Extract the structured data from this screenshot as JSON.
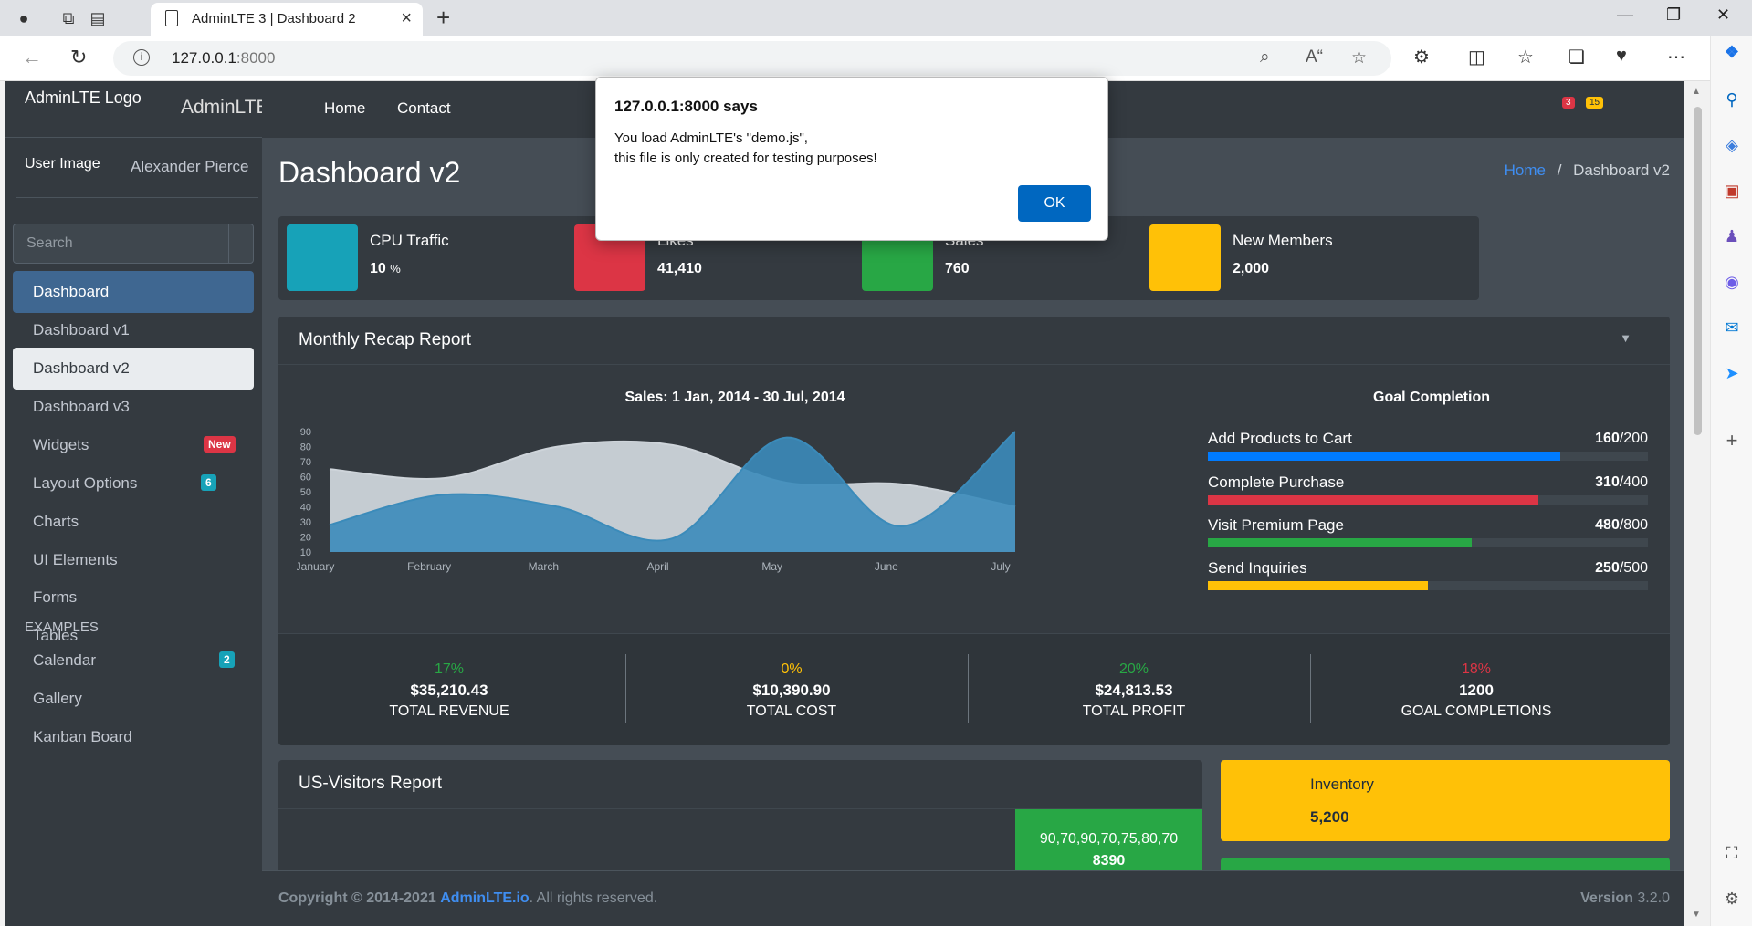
{
  "browser": {
    "tab_title": "AdminLTE 3 | Dashboard 2",
    "url_host": "127.0.0.1",
    "url_port": ":8000"
  },
  "dialog": {
    "title": "127.0.0.1:8000 says",
    "line1": "You load AdminLTE's \"demo.js\",",
    "line2": "this file is only created for testing purposes!",
    "ok_label": "OK"
  },
  "brand": {
    "logo_alt": "AdminLTE Logo",
    "text": "AdminLTE"
  },
  "user": {
    "image_alt": "User Image",
    "name": "Alexander Pierce"
  },
  "search": {
    "placeholder": "Search"
  },
  "sidebar": {
    "items": [
      {
        "label": "Dashboard"
      },
      {
        "label": "Dashboard v1"
      },
      {
        "label": "Dashboard v2"
      },
      {
        "label": "Dashboard v3"
      },
      {
        "label": "Widgets",
        "badge": "New"
      },
      {
        "label": "Layout Options",
        "badge": "6"
      },
      {
        "label": "Charts"
      },
      {
        "label": "UI Elements"
      },
      {
        "label": "Forms"
      },
      {
        "label": "Tables"
      }
    ],
    "header": "EXAMPLES",
    "examples": [
      {
        "label": "Calendar",
        "badge": "2"
      },
      {
        "label": "Gallery"
      },
      {
        "label": "Kanban Board"
      }
    ]
  },
  "topnav": {
    "home": "Home",
    "contact": "Contact",
    "badge_messages": "3",
    "badge_notifications": "15"
  },
  "page": {
    "title": "Dashboard v2",
    "crumb_home": "Home",
    "crumb_sep": "/",
    "crumb_current": "Dashboard v2"
  },
  "infoboxes": [
    {
      "title": "CPU Traffic",
      "value": "10",
      "unit": "%",
      "color": "#17a2b8"
    },
    {
      "title": "Likes",
      "value": "41,410",
      "unit": "",
      "color": "#dc3545"
    },
    {
      "title": "Sales",
      "value": "760",
      "unit": "",
      "color": "#28a745"
    },
    {
      "title": "New Members",
      "value": "2,000",
      "unit": "",
      "color": "#ffc107"
    }
  ],
  "recap": {
    "title": "Monthly Recap Report",
    "chart_title": "Sales: 1 Jan, 2014 - 30 Jul, 2014",
    "goal_title": "Goal Completion",
    "goals": [
      {
        "label": "Add Products to Cart",
        "done": "160",
        "total": "/200",
        "fraction": 0.8,
        "color": "#007bff"
      },
      {
        "label": "Complete Purchase",
        "done": "310",
        "total": "/400",
        "fraction": 0.75,
        "color": "#dc3545"
      },
      {
        "label": "Visit Premium Page",
        "done": "480",
        "total": "/800",
        "fraction": 0.6,
        "color": "#28a745"
      },
      {
        "label": "Send Inquiries",
        "done": "250",
        "total": "/500",
        "fraction": 0.5,
        "color": "#ffc107"
      }
    ],
    "stats": [
      {
        "pct": "17%",
        "amount": "$35,210.43",
        "label": "TOTAL REVENUE",
        "color": "#28a745"
      },
      {
        "pct": "0%",
        "amount": "$10,390.90",
        "label": "TOTAL COST",
        "color": "#ffc107"
      },
      {
        "pct": "20%",
        "amount": "$24,813.53",
        "label": "TOTAL PROFIT",
        "color": "#28a745"
      },
      {
        "pct": "18%",
        "amount": "1200",
        "label": "GOAL COMPLETIONS",
        "color": "#dc3545"
      }
    ]
  },
  "chart_data": {
    "type": "area",
    "title": "Sales: 1 Jan, 2014 - 30 Jul, 2014",
    "categories": [
      "January",
      "February",
      "March",
      "April",
      "May",
      "June",
      "July"
    ],
    "ylim": [
      10,
      90
    ],
    "yticks": [
      10,
      20,
      30,
      40,
      50,
      60,
      70,
      80,
      90
    ],
    "series": [
      {
        "values": [
          65,
          59,
          80,
          81,
          56,
          55,
          40
        ],
        "color": "#ced4da"
      },
      {
        "values": [
          28,
          48,
          40,
          19,
          86,
          27,
          90
        ],
        "color": "#3b8bba"
      }
    ],
    "grid": false,
    "legend": "none"
  },
  "visitors": {
    "title": "US-Visitors Report",
    "spark_values": "90,70,90,70,75,80,70",
    "spark_total": "8390"
  },
  "inventory": {
    "title": "Inventory",
    "value": "5,200"
  },
  "footer": {
    "copyright": "Copyright © 2014-2021",
    "brand_link": "AdminLTE.io",
    "rights": ". All rights reserved.",
    "version_label": "Version",
    "version": "3.2.0"
  }
}
